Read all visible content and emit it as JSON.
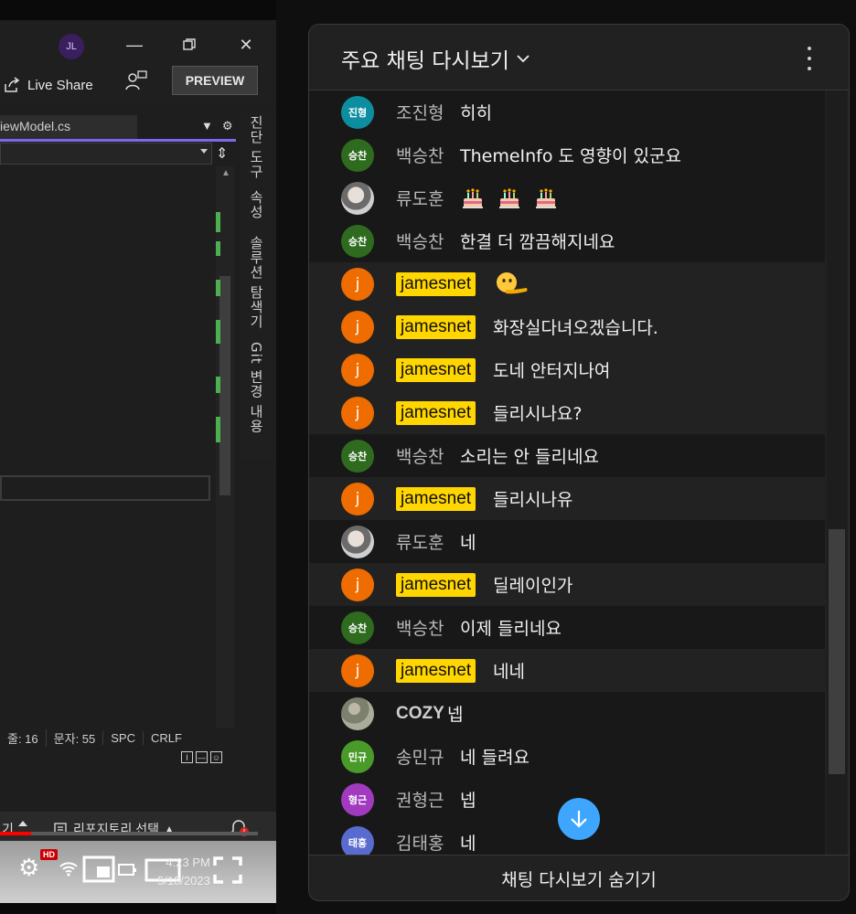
{
  "ide": {
    "avatar_initials": "JL",
    "live_share_label": "Live Share",
    "preview_label": "PREVIEW",
    "file_tab": "iewModel.cs",
    "status_line": "줄: 16",
    "status_col": "문자: 55",
    "status_spc": "SPC",
    "status_crlf": "CRLF",
    "side_panels": [
      "진단 도구",
      "속성",
      "솔루션 탐색기",
      "Git 변경 내용"
    ],
    "repo_label": "리포지토리 선택",
    "clock_time": "4:23 PM",
    "clock_date": "5/18/2023",
    "hd_badge": "HD",
    "progress_fraction": 0.12,
    "accent_color": "#7b68ee"
  },
  "chat": {
    "title": "주요 채팅 다시보기",
    "footer_label": "채팅 다시보기 숨기기",
    "owner_badge_color": "#ffd600",
    "messages": [
      {
        "avatar": "진형",
        "avatar_color": "#0d8ea0",
        "author": "조진형",
        "text": "히히",
        "owner": false
      },
      {
        "avatar": "승찬",
        "avatar_color": "#2e6b1f",
        "author": "백승찬",
        "text": "ThemeInfo 도 영향이 있군요",
        "owner": false
      },
      {
        "avatar": "photo",
        "author": "류도훈",
        "text": "",
        "emoji": "birthday-cake x3",
        "owner": false
      },
      {
        "avatar": "승찬",
        "avatar_color": "#2e6b1f",
        "author": "백승찬",
        "text": "한결 더 깜끔해지네요",
        "owner": false
      },
      {
        "avatar": "j",
        "author": "jamesnet",
        "text": "",
        "emoji": "face-with-peeking-eye",
        "owner": true
      },
      {
        "avatar": "j",
        "author": "jamesnet",
        "text": "화장실다녀오겠습니다.",
        "owner": true
      },
      {
        "avatar": "j",
        "author": "jamesnet",
        "text": "도네 안터지나여",
        "owner": true
      },
      {
        "avatar": "j",
        "author": "jamesnet",
        "text": "들리시나요?",
        "owner": true
      },
      {
        "avatar": "승찬",
        "avatar_color": "#2e6b1f",
        "author": "백승찬",
        "text": "소리는 안 들리네요",
        "owner": false
      },
      {
        "avatar": "j",
        "author": "jamesnet",
        "text": "들리시나유",
        "owner": true
      },
      {
        "avatar": "photo",
        "author": "류도훈",
        "text": "네",
        "owner": false
      },
      {
        "avatar": "j",
        "author": "jamesnet",
        "text": "딜레이인가",
        "owner": true
      },
      {
        "avatar": "승찬",
        "avatar_color": "#2e6b1f",
        "author": "백승찬",
        "text": "이제 들리네요",
        "owner": false
      },
      {
        "avatar": "j",
        "author": "jamesnet",
        "text": "네네",
        "owner": true
      },
      {
        "avatar": "photo2",
        "author": "COZY",
        "text": "넵",
        "owner": false
      },
      {
        "avatar": "민규",
        "avatar_color": "#4a9a2a",
        "author": "송민규",
        "text": "네 들려요",
        "owner": false
      },
      {
        "avatar": "형근",
        "avatar_color": "#a23ac0",
        "author": "권형근",
        "text": "넵",
        "owner": false
      },
      {
        "avatar": "태홍",
        "avatar_color": "#5a6bd0",
        "author": "김태홍",
        "text": "네",
        "owner": false
      }
    ]
  }
}
